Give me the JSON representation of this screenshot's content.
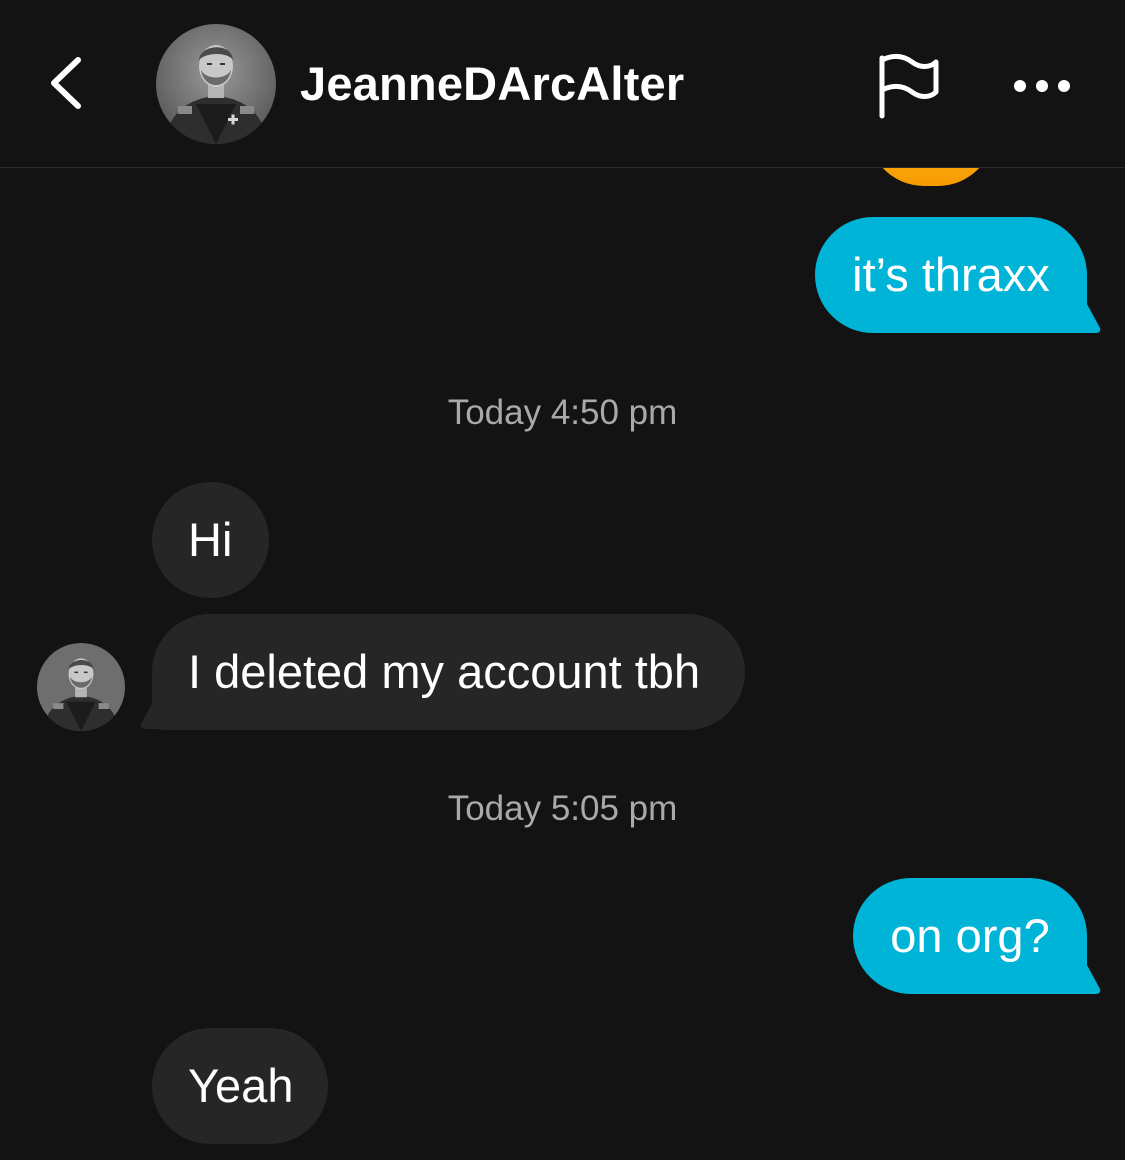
{
  "header": {
    "contact_name": "JeanneDArcAlter",
    "avatar_icon": "person-portrait-avatar",
    "back_icon": "chevron-left-icon",
    "report_icon": "flag-icon",
    "more_icon": "more-horizontal-icon"
  },
  "messages": [
    {
      "type": "outgoing",
      "text": "it’s thraxx"
    },
    {
      "type": "timestamp",
      "text": "Today 4:50 pm"
    },
    {
      "type": "incoming",
      "text": "Hi"
    },
    {
      "type": "incoming",
      "text": "I deleted my account tbh"
    },
    {
      "type": "timestamp",
      "text": "Today 5:05 pm"
    },
    {
      "type": "outgoing",
      "text": "on org?"
    },
    {
      "type": "incoming",
      "text": "Yeah"
    }
  ],
  "colors": {
    "background": "#131313",
    "outgoing_bubble": "#00b4d8",
    "incoming_bubble": "#262626",
    "timestamp_text": "#a9a9a9",
    "sticker": "#f9a50c"
  }
}
